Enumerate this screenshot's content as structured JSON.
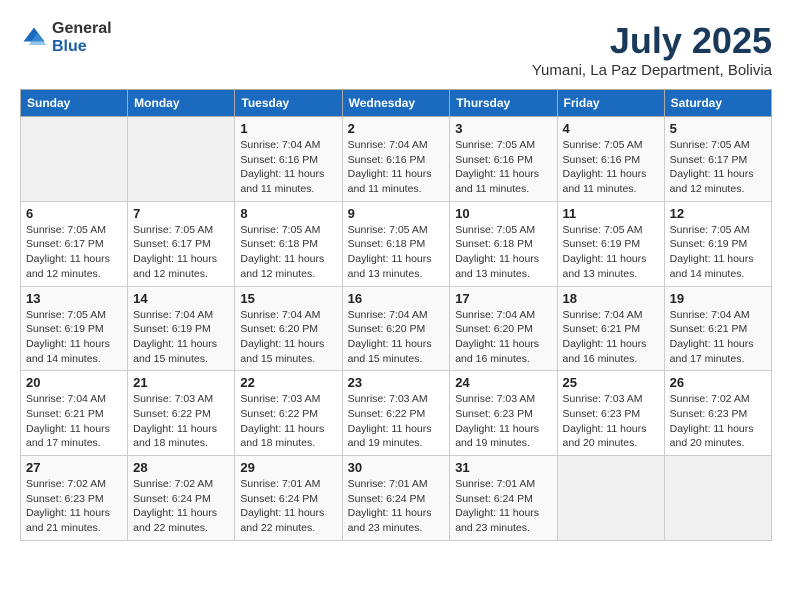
{
  "logo": {
    "general": "General",
    "blue": "Blue"
  },
  "header": {
    "month_year": "July 2025",
    "location": "Yumani, La Paz Department, Bolivia"
  },
  "weekdays": [
    "Sunday",
    "Monday",
    "Tuesday",
    "Wednesday",
    "Thursday",
    "Friday",
    "Saturday"
  ],
  "weeks": [
    [
      {
        "day": "",
        "info": ""
      },
      {
        "day": "",
        "info": ""
      },
      {
        "day": "1",
        "info": "Sunrise: 7:04 AM\nSunset: 6:16 PM\nDaylight: 11 hours and 11 minutes."
      },
      {
        "day": "2",
        "info": "Sunrise: 7:04 AM\nSunset: 6:16 PM\nDaylight: 11 hours and 11 minutes."
      },
      {
        "day": "3",
        "info": "Sunrise: 7:05 AM\nSunset: 6:16 PM\nDaylight: 11 hours and 11 minutes."
      },
      {
        "day": "4",
        "info": "Sunrise: 7:05 AM\nSunset: 6:16 PM\nDaylight: 11 hours and 11 minutes."
      },
      {
        "day": "5",
        "info": "Sunrise: 7:05 AM\nSunset: 6:17 PM\nDaylight: 11 hours and 12 minutes."
      }
    ],
    [
      {
        "day": "6",
        "info": "Sunrise: 7:05 AM\nSunset: 6:17 PM\nDaylight: 11 hours and 12 minutes."
      },
      {
        "day": "7",
        "info": "Sunrise: 7:05 AM\nSunset: 6:17 PM\nDaylight: 11 hours and 12 minutes."
      },
      {
        "day": "8",
        "info": "Sunrise: 7:05 AM\nSunset: 6:18 PM\nDaylight: 11 hours and 12 minutes."
      },
      {
        "day": "9",
        "info": "Sunrise: 7:05 AM\nSunset: 6:18 PM\nDaylight: 11 hours and 13 minutes."
      },
      {
        "day": "10",
        "info": "Sunrise: 7:05 AM\nSunset: 6:18 PM\nDaylight: 11 hours and 13 minutes."
      },
      {
        "day": "11",
        "info": "Sunrise: 7:05 AM\nSunset: 6:19 PM\nDaylight: 11 hours and 13 minutes."
      },
      {
        "day": "12",
        "info": "Sunrise: 7:05 AM\nSunset: 6:19 PM\nDaylight: 11 hours and 14 minutes."
      }
    ],
    [
      {
        "day": "13",
        "info": "Sunrise: 7:05 AM\nSunset: 6:19 PM\nDaylight: 11 hours and 14 minutes."
      },
      {
        "day": "14",
        "info": "Sunrise: 7:04 AM\nSunset: 6:19 PM\nDaylight: 11 hours and 15 minutes."
      },
      {
        "day": "15",
        "info": "Sunrise: 7:04 AM\nSunset: 6:20 PM\nDaylight: 11 hours and 15 minutes."
      },
      {
        "day": "16",
        "info": "Sunrise: 7:04 AM\nSunset: 6:20 PM\nDaylight: 11 hours and 15 minutes."
      },
      {
        "day": "17",
        "info": "Sunrise: 7:04 AM\nSunset: 6:20 PM\nDaylight: 11 hours and 16 minutes."
      },
      {
        "day": "18",
        "info": "Sunrise: 7:04 AM\nSunset: 6:21 PM\nDaylight: 11 hours and 16 minutes."
      },
      {
        "day": "19",
        "info": "Sunrise: 7:04 AM\nSunset: 6:21 PM\nDaylight: 11 hours and 17 minutes."
      }
    ],
    [
      {
        "day": "20",
        "info": "Sunrise: 7:04 AM\nSunset: 6:21 PM\nDaylight: 11 hours and 17 minutes."
      },
      {
        "day": "21",
        "info": "Sunrise: 7:03 AM\nSunset: 6:22 PM\nDaylight: 11 hours and 18 minutes."
      },
      {
        "day": "22",
        "info": "Sunrise: 7:03 AM\nSunset: 6:22 PM\nDaylight: 11 hours and 18 minutes."
      },
      {
        "day": "23",
        "info": "Sunrise: 7:03 AM\nSunset: 6:22 PM\nDaylight: 11 hours and 19 minutes."
      },
      {
        "day": "24",
        "info": "Sunrise: 7:03 AM\nSunset: 6:23 PM\nDaylight: 11 hours and 19 minutes."
      },
      {
        "day": "25",
        "info": "Sunrise: 7:03 AM\nSunset: 6:23 PM\nDaylight: 11 hours and 20 minutes."
      },
      {
        "day": "26",
        "info": "Sunrise: 7:02 AM\nSunset: 6:23 PM\nDaylight: 11 hours and 20 minutes."
      }
    ],
    [
      {
        "day": "27",
        "info": "Sunrise: 7:02 AM\nSunset: 6:23 PM\nDaylight: 11 hours and 21 minutes."
      },
      {
        "day": "28",
        "info": "Sunrise: 7:02 AM\nSunset: 6:24 PM\nDaylight: 11 hours and 22 minutes."
      },
      {
        "day": "29",
        "info": "Sunrise: 7:01 AM\nSunset: 6:24 PM\nDaylight: 11 hours and 22 minutes."
      },
      {
        "day": "30",
        "info": "Sunrise: 7:01 AM\nSunset: 6:24 PM\nDaylight: 11 hours and 23 minutes."
      },
      {
        "day": "31",
        "info": "Sunrise: 7:01 AM\nSunset: 6:24 PM\nDaylight: 11 hours and 23 minutes."
      },
      {
        "day": "",
        "info": ""
      },
      {
        "day": "",
        "info": ""
      }
    ]
  ]
}
